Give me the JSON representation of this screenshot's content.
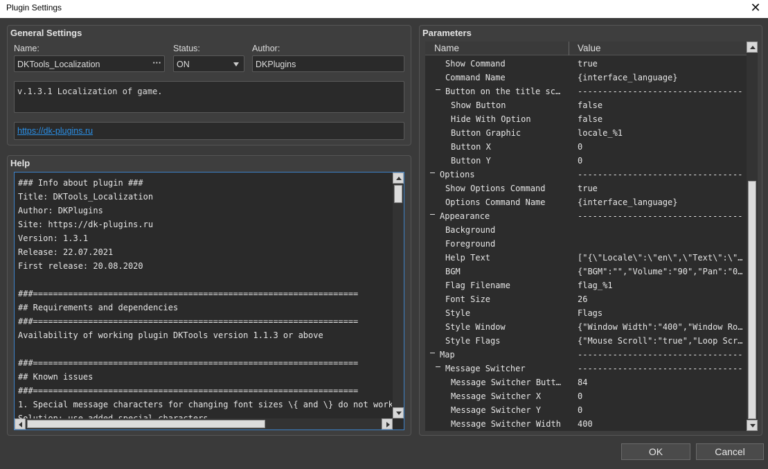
{
  "window": {
    "title": "Plugin Settings",
    "close_glyph": "✕"
  },
  "general": {
    "title": "General Settings",
    "name_label": "Name:",
    "name_value": "DKTools_Localization",
    "name_button": "···",
    "status_label": "Status:",
    "status_value": "ON",
    "author_label": "Author:",
    "author_value": "DKPlugins",
    "description": "v.1.3.1 Localization of game.",
    "url": "https://dk-plugins.ru"
  },
  "help": {
    "title": "Help",
    "text": "### Info about plugin ###\nTitle: DKTools_Localization\nAuthor: DKPlugins\nSite: https://dk-plugins.ru\nVersion: 1.3.1\nRelease: 22.07.2021\nFirst release: 20.08.2020\n\n###=================================================================\n## Requirements and dependencies\n###=================================================================\nAvailability of working plugin DKTools version 1.1.3 or above\n\n###=================================================================\n## Known issues\n###=================================================================\n1. Special message characters for changing font sizes \\{ and \\} do not work\nSolution: use added special characters"
  },
  "parameters": {
    "title": "Parameters",
    "col_name": "Name",
    "col_value": "Value",
    "rows": [
      {
        "name": "Show Command",
        "value": "true",
        "indent": 1,
        "expander": false
      },
      {
        "name": "Command Name",
        "value": "{interface_language}",
        "indent": 1,
        "expander": false
      },
      {
        "name": "Button on the title scr…",
        "value": "---------------------------------",
        "indent": 1,
        "expander": true
      },
      {
        "name": "Show Button",
        "value": "false",
        "indent": 2,
        "expander": false
      },
      {
        "name": "Hide With Option",
        "value": "false",
        "indent": 2,
        "expander": false
      },
      {
        "name": "Button Graphic",
        "value": "locale_%1",
        "indent": 2,
        "expander": false
      },
      {
        "name": "Button X",
        "value": "0",
        "indent": 2,
        "expander": false
      },
      {
        "name": "Button Y",
        "value": "0",
        "indent": 2,
        "expander": false
      },
      {
        "name": "Options",
        "value": "---------------------------------",
        "indent": 0,
        "expander": true
      },
      {
        "name": "Show Options Command",
        "value": "true",
        "indent": 1,
        "expander": false
      },
      {
        "name": "Options Command Name",
        "value": "{interface_language}",
        "indent": 1,
        "expander": false
      },
      {
        "name": "Appearance",
        "value": "---------------------------------",
        "indent": 0,
        "expander": true
      },
      {
        "name": "Background",
        "value": "",
        "indent": 1,
        "expander": false
      },
      {
        "name": "Foreground",
        "value": "",
        "indent": 1,
        "expander": false
      },
      {
        "name": "Help Text",
        "value": "[\"{\\\"Locale\\\":\\\"en\\\",\\\"Text\\\":\\\"…",
        "indent": 1,
        "expander": false
      },
      {
        "name": "BGM",
        "value": "{\"BGM\":\"\",\"Volume\":\"90\",\"Pan\":\"0…",
        "indent": 1,
        "expander": false
      },
      {
        "name": "Flag Filename",
        "value": "flag_%1",
        "indent": 1,
        "expander": false
      },
      {
        "name": "Font Size",
        "value": "26",
        "indent": 1,
        "expander": false
      },
      {
        "name": "Style",
        "value": "Flags",
        "indent": 1,
        "expander": false
      },
      {
        "name": "Style Window",
        "value": "{\"Window Width\":\"400\",\"Window Ro…",
        "indent": 1,
        "expander": false
      },
      {
        "name": "Style Flags",
        "value": "{\"Mouse Scroll\":\"true\",\"Loop Scr…",
        "indent": 1,
        "expander": false
      },
      {
        "name": "Map",
        "value": "---------------------------------",
        "indent": 0,
        "expander": true
      },
      {
        "name": "Message Switcher",
        "value": "---------------------------------",
        "indent": 1,
        "expander": true
      },
      {
        "name": "Message Switcher Button",
        "value": "84",
        "indent": 2,
        "expander": false
      },
      {
        "name": "Message Switcher X",
        "value": "0",
        "indent": 2,
        "expander": false
      },
      {
        "name": "Message Switcher Y",
        "value": "0",
        "indent": 2,
        "expander": false
      },
      {
        "name": "Message Switcher Width",
        "value": "400",
        "indent": 2,
        "expander": false
      }
    ]
  },
  "buttons": {
    "ok": "OK",
    "cancel": "Cancel"
  },
  "colors": {
    "background": "#3a3a3a",
    "field": "#2a2a2a",
    "link": "#2a8fe6",
    "focus_border": "#3e82c8"
  }
}
